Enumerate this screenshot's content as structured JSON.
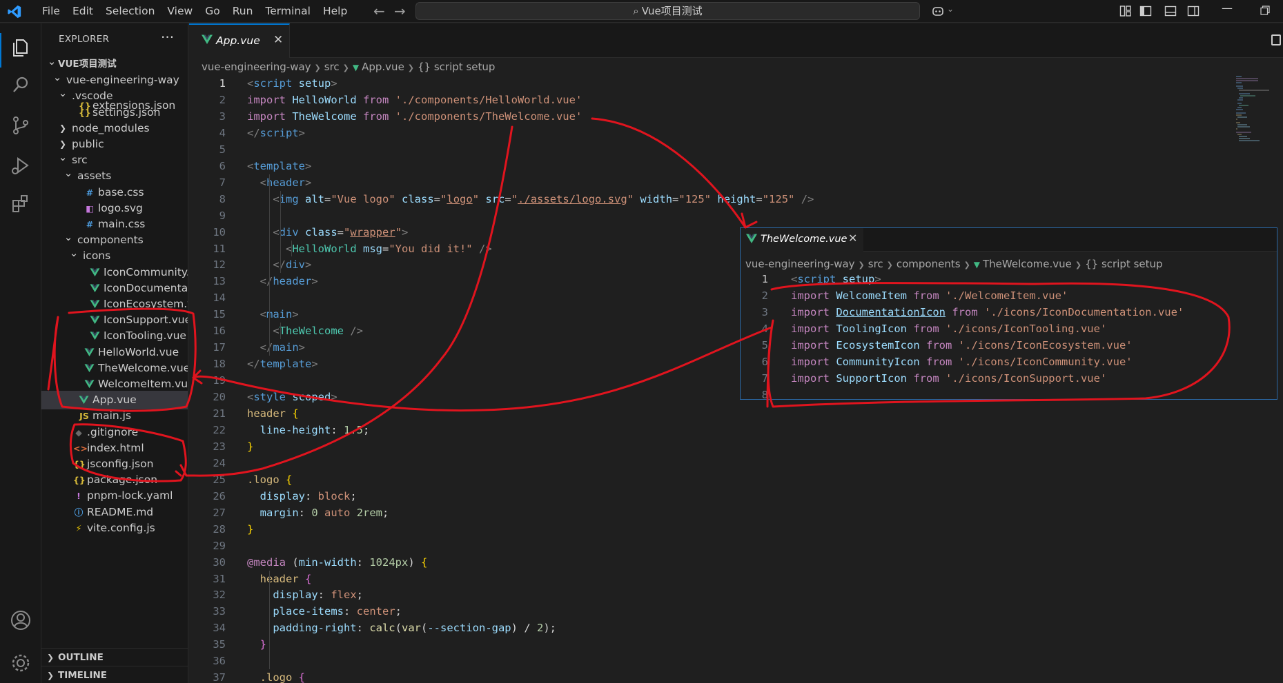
{
  "titlebar": {
    "menu": [
      "File",
      "Edit",
      "Selection",
      "View",
      "Go",
      "Run",
      "Terminal",
      "Help"
    ],
    "search_text": "Vue项目测试"
  },
  "sidebar": {
    "title": "EXPLORER",
    "more": "···",
    "tree": [
      {
        "label": "VUE项目测试",
        "depth": 0,
        "kind": "root",
        "twistie": "open"
      },
      {
        "label": "vue-engineering-way",
        "depth": 1,
        "kind": "folder",
        "twistie": "open"
      },
      {
        "label": ".vscode",
        "depth": 2,
        "kind": "folder",
        "twistie": "open"
      },
      {
        "label": "extensions.json",
        "depth": 3,
        "kind": "json",
        "cut": true
      },
      {
        "label": "settings.json",
        "depth": 3,
        "kind": "json"
      },
      {
        "label": "node_modules",
        "depth": 2,
        "kind": "folder",
        "twistie": "closed"
      },
      {
        "label": "public",
        "depth": 2,
        "kind": "folder",
        "twistie": "closed"
      },
      {
        "label": "src",
        "depth": 2,
        "kind": "folder",
        "twistie": "open"
      },
      {
        "label": "assets",
        "depth": 3,
        "kind": "folder",
        "twistie": "open"
      },
      {
        "label": "base.css",
        "depth": 4,
        "kind": "css"
      },
      {
        "label": "logo.svg",
        "depth": 4,
        "kind": "svg"
      },
      {
        "label": "main.css",
        "depth": 4,
        "kind": "css"
      },
      {
        "label": "components",
        "depth": 3,
        "kind": "folder",
        "twistie": "open"
      },
      {
        "label": "icons",
        "depth": 4,
        "kind": "folder",
        "twistie": "open"
      },
      {
        "label": "IconCommunity...",
        "depth": 5,
        "kind": "vue"
      },
      {
        "label": "IconDocumenta...",
        "depth": 5,
        "kind": "vue"
      },
      {
        "label": "IconEcosystem.v...",
        "depth": 5,
        "kind": "vue"
      },
      {
        "label": "IconSupport.vue",
        "depth": 5,
        "kind": "vue"
      },
      {
        "label": "IconTooling.vue",
        "depth": 5,
        "kind": "vue"
      },
      {
        "label": "HelloWorld.vue",
        "depth": 4,
        "kind": "vue"
      },
      {
        "label": "TheWelcome.vue",
        "depth": 4,
        "kind": "vue"
      },
      {
        "label": "WelcomeItem.vue",
        "depth": 4,
        "kind": "vue"
      },
      {
        "label": "App.vue",
        "depth": 3,
        "kind": "vue",
        "selected": true
      },
      {
        "label": "main.js",
        "depth": 3,
        "kind": "js"
      },
      {
        "label": ".gitignore",
        "depth": 2,
        "kind": "git"
      },
      {
        "label": "index.html",
        "depth": 2,
        "kind": "html"
      },
      {
        "label": "jsconfig.json",
        "depth": 2,
        "kind": "json"
      },
      {
        "label": "package.json",
        "depth": 2,
        "kind": "json"
      },
      {
        "label": "pnpm-lock.yaml",
        "depth": 2,
        "kind": "yaml"
      },
      {
        "label": "README.md",
        "depth": 2,
        "kind": "info"
      },
      {
        "label": "vite.config.js",
        "depth": 2,
        "kind": "vite"
      }
    ],
    "outline": "OUTLINE",
    "timeline": "TIMELINE"
  },
  "icons": {
    "vue": "vue-file-icon",
    "json": "json-braces-icon",
    "css": "css-hash-icon",
    "svg": "svg-image-icon",
    "js": "js-file-icon",
    "git": "git-diamond-icon",
    "html": "html-brackets-icon",
    "yaml": "yaml-exclamation-icon",
    "info": "info-circle-icon",
    "vite": "vite-bolt-icon"
  },
  "editor": {
    "tab_label": "App.vue",
    "close": "✕",
    "breadcrumb": [
      "vue-engineering-way",
      "src",
      "App.vue",
      "{} script setup"
    ],
    "active_line": 1,
    "lines": [
      [
        [
          "<",
          "t"
        ],
        [
          "script",
          "n"
        ],
        [
          " setup",
          "a"
        ],
        [
          ">",
          "t"
        ]
      ],
      [
        [
          "import",
          "i"
        ],
        [
          " HelloWorld ",
          "a"
        ],
        [
          "from",
          "i"
        ],
        [
          " ",
          "p"
        ],
        [
          "'./components/HelloWorld.vue'",
          "s"
        ]
      ],
      [
        [
          "import",
          "i"
        ],
        [
          " TheWelcome ",
          "a"
        ],
        [
          "from",
          "i"
        ],
        [
          " ",
          "p"
        ],
        [
          "'./components/TheWelcome.vue'",
          "s"
        ]
      ],
      [
        [
          "</",
          "t"
        ],
        [
          "script",
          "n"
        ],
        [
          ">",
          "t"
        ]
      ],
      [],
      [
        [
          "<",
          "t"
        ],
        [
          "template",
          "n"
        ],
        [
          ">",
          "t"
        ]
      ],
      [
        [
          "  <",
          "t"
        ],
        [
          "header",
          "n"
        ],
        [
          ">",
          "t"
        ]
      ],
      [
        [
          "    <",
          "t"
        ],
        [
          "img",
          "n"
        ],
        [
          " alt",
          "a"
        ],
        [
          "=",
          "p"
        ],
        [
          "\"Vue logo\"",
          "s"
        ],
        [
          " class",
          "a"
        ],
        [
          "=",
          "p"
        ],
        [
          "\"",
          "s"
        ],
        [
          "logo",
          "su"
        ],
        [
          "\"",
          "s"
        ],
        [
          " src",
          "a"
        ],
        [
          "=",
          "p"
        ],
        [
          "\"",
          "s"
        ],
        [
          "./assets/logo.svg",
          "su"
        ],
        [
          "\"",
          "s"
        ],
        [
          " width",
          "a"
        ],
        [
          "=",
          "p"
        ],
        [
          "\"125\"",
          "s"
        ],
        [
          " height",
          "a"
        ],
        [
          "=",
          "p"
        ],
        [
          "\"125\"",
          "s"
        ],
        [
          " />",
          "t"
        ]
      ],
      [],
      [
        [
          "    <",
          "t"
        ],
        [
          "div",
          "n"
        ],
        [
          " class",
          "a"
        ],
        [
          "=",
          "p"
        ],
        [
          "\"",
          "s"
        ],
        [
          "wrapper",
          "su"
        ],
        [
          "\"",
          "s"
        ],
        [
          ">",
          "t"
        ]
      ],
      [
        [
          "      <",
          "t"
        ],
        [
          "HelloWorld",
          "c"
        ],
        [
          " msg",
          "a"
        ],
        [
          "=",
          "p"
        ],
        [
          "\"You did it!\"",
          "s"
        ],
        [
          " />",
          "t"
        ]
      ],
      [
        [
          "    </",
          "t"
        ],
        [
          "div",
          "n"
        ],
        [
          ">",
          "t"
        ]
      ],
      [
        [
          "  </",
          "t"
        ],
        [
          "header",
          "n"
        ],
        [
          ">",
          "t"
        ]
      ],
      [],
      [
        [
          "  <",
          "t"
        ],
        [
          "main",
          "n"
        ],
        [
          ">",
          "t"
        ]
      ],
      [
        [
          "    <",
          "t"
        ],
        [
          "TheWelcome",
          "c"
        ],
        [
          " />",
          "t"
        ]
      ],
      [
        [
          "  </",
          "t"
        ],
        [
          "main",
          "n"
        ],
        [
          ">",
          "t"
        ]
      ],
      [
        [
          "</",
          "t"
        ],
        [
          "template",
          "n"
        ],
        [
          ">",
          "t"
        ]
      ],
      [],
      [
        [
          "<",
          "t"
        ],
        [
          "style",
          "n"
        ],
        [
          " scoped",
          "a"
        ],
        [
          ">",
          "t"
        ]
      ],
      [
        [
          "header",
          "y"
        ],
        [
          " ",
          "p"
        ],
        [
          "{",
          "b"
        ]
      ],
      [
        [
          "  line-height",
          "a"
        ],
        [
          ": ",
          "p"
        ],
        [
          "1.5",
          "num"
        ],
        [
          ";",
          "p"
        ]
      ],
      [
        [
          "}",
          "b"
        ]
      ],
      [],
      [
        [
          ".logo",
          "y"
        ],
        [
          " ",
          "p"
        ],
        [
          "{",
          "b"
        ]
      ],
      [
        [
          "  display",
          "a"
        ],
        [
          ": ",
          "p"
        ],
        [
          "block",
          "s"
        ],
        [
          ";",
          "p"
        ]
      ],
      [
        [
          "  margin",
          "a"
        ],
        [
          ": ",
          "p"
        ],
        [
          "0",
          "num"
        ],
        [
          " ",
          "p"
        ],
        [
          "auto",
          "s"
        ],
        [
          " ",
          "p"
        ],
        [
          "2rem",
          "num"
        ],
        [
          ";",
          "p"
        ]
      ],
      [
        [
          "}",
          "b"
        ]
      ],
      [],
      [
        [
          "@media",
          "i"
        ],
        [
          " (",
          "p"
        ],
        [
          "min-width",
          "a"
        ],
        [
          ": ",
          "p"
        ],
        [
          "1024px",
          "num"
        ],
        [
          ") ",
          "p"
        ],
        [
          "{",
          "b"
        ]
      ],
      [
        [
          "  header",
          "y"
        ],
        [
          " ",
          "p"
        ],
        [
          "{",
          "pl"
        ]
      ],
      [
        [
          "    display",
          "a"
        ],
        [
          ": ",
          "p"
        ],
        [
          "flex",
          "s"
        ],
        [
          ";",
          "p"
        ]
      ],
      [
        [
          "    place-items",
          "a"
        ],
        [
          ": ",
          "p"
        ],
        [
          "center",
          "s"
        ],
        [
          ";",
          "p"
        ]
      ],
      [
        [
          "    padding-right",
          "a"
        ],
        [
          ": ",
          "p"
        ],
        [
          "calc",
          "f"
        ],
        [
          "(",
          "p"
        ],
        [
          "var",
          "f"
        ],
        [
          "(",
          "p"
        ],
        [
          "--section-gap",
          "a"
        ],
        [
          ") / ",
          "p"
        ],
        [
          "2",
          "num"
        ],
        [
          ");",
          "p"
        ]
      ],
      [
        [
          "  }",
          "pl"
        ]
      ],
      [],
      [
        [
          "  .logo",
          "y"
        ],
        [
          " ",
          "p"
        ],
        [
          "{",
          "pl"
        ]
      ]
    ]
  },
  "float_window": {
    "tab_label": "TheWelcome.vue",
    "close": "✕",
    "breadcrumb": [
      "vue-engineering-way",
      "src",
      "components",
      "TheWelcome.vue",
      "{} script setup"
    ],
    "lines": [
      [
        [
          "<",
          "t"
        ],
        [
          "script",
          "n"
        ],
        [
          " setup",
          "a"
        ],
        [
          ">",
          "t"
        ]
      ],
      [
        [
          "import",
          "i"
        ],
        [
          " WelcomeItem ",
          "a"
        ],
        [
          "from",
          "i"
        ],
        [
          " ",
          "p"
        ],
        [
          "'./WelcomeItem.vue'",
          "s"
        ]
      ],
      [
        [
          "import",
          "i"
        ],
        [
          " ",
          "p"
        ],
        [
          "DocumentationIcon",
          "au"
        ],
        [
          " ",
          "p"
        ],
        [
          "from",
          "i"
        ],
        [
          " ",
          "p"
        ],
        [
          "'./icons/IconDocumentation.vue'",
          "s"
        ]
      ],
      [
        [
          "import",
          "i"
        ],
        [
          " ToolingIcon ",
          "a"
        ],
        [
          "from",
          "i"
        ],
        [
          " ",
          "p"
        ],
        [
          "'./icons/IconTooling.vue'",
          "s"
        ]
      ],
      [
        [
          "import",
          "i"
        ],
        [
          " EcosystemIcon ",
          "a"
        ],
        [
          "from",
          "i"
        ],
        [
          " ",
          "p"
        ],
        [
          "'./icons/IconEcosystem.vue'",
          "s"
        ]
      ],
      [
        [
          "import",
          "i"
        ],
        [
          " CommunityIcon ",
          "a"
        ],
        [
          "from",
          "i"
        ],
        [
          " ",
          "p"
        ],
        [
          "'./icons/IconCommunity.vue'",
          "s"
        ]
      ],
      [
        [
          "import",
          "i"
        ],
        [
          " SupportIcon ",
          "a"
        ],
        [
          "from",
          "i"
        ],
        [
          " ",
          "p"
        ],
        [
          "'./icons/IconSupport.vue'",
          "s"
        ]
      ],
      []
    ]
  },
  "colors": {
    "accent": "#0078d4",
    "annotation_red": "#e0141e",
    "vue_green": "#41b883"
  }
}
